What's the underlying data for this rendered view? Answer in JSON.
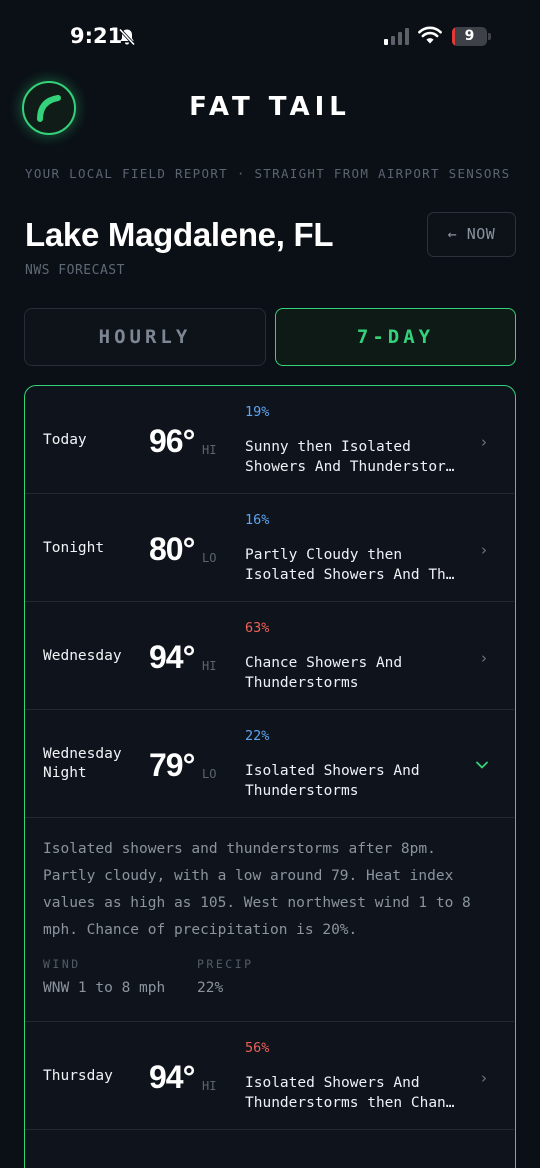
{
  "status_bar": {
    "time": "9:21",
    "battery_level": "9",
    "battery_fraction": 0.09,
    "signal_bars_active": 1
  },
  "header": {
    "app_title": "FAT TAIL",
    "tagline": "YOUR LOCAL FIELD REPORT · STRAIGHT FROM AIRPORT SENSORS",
    "location": "Lake Magdalene, FL",
    "source": "NWS FORECAST",
    "now_button": "← NOW"
  },
  "tabs": [
    {
      "label": "HOURLY",
      "active": false
    },
    {
      "label": "7-DAY",
      "active": true
    }
  ],
  "colors": {
    "accent": "#34d27b",
    "pop_low": "#5ea4ee",
    "pop_high": "#ec6158",
    "background": "#0b1016"
  },
  "forecast": [
    {
      "name": "Today",
      "temp": "96°",
      "kind": "HI",
      "pop": "19%",
      "pop_color": "blue",
      "desc": "Sunny then Isolated Showers And Thunderstor…"
    },
    {
      "name": "Tonight",
      "temp": "80°",
      "kind": "LO",
      "pop": "16%",
      "pop_color": "blue",
      "desc": "Partly Cloudy then Isolated Showers And Th…"
    },
    {
      "name": "Wednesday",
      "temp": "94°",
      "kind": "HI",
      "pop": "63%",
      "pop_color": "red",
      "desc": "Chance Showers And Thunderstorms"
    },
    {
      "name": "Wednesday Night",
      "temp": "79°",
      "kind": "LO",
      "pop": "22%",
      "pop_color": "blue",
      "desc": "Isolated Showers And Thunderstorms",
      "expanded": true
    },
    {
      "name": "Thursday",
      "temp": "94°",
      "kind": "HI",
      "pop": "56%",
      "pop_color": "red",
      "desc": "Isolated Showers And Thunderstorms then Chan…"
    }
  ],
  "details": {
    "text": "Isolated showers and thunderstorms after 8pm. Partly cloudy, with a low around 79. Heat index values as high as 105. West northwest wind 1 to 8 mph. Chance of precipitation is 20%.",
    "wind_label": "WIND",
    "wind_value": "WNW 1 to 8 mph",
    "precip_label": "PRECIP",
    "precip_value": "22%"
  }
}
